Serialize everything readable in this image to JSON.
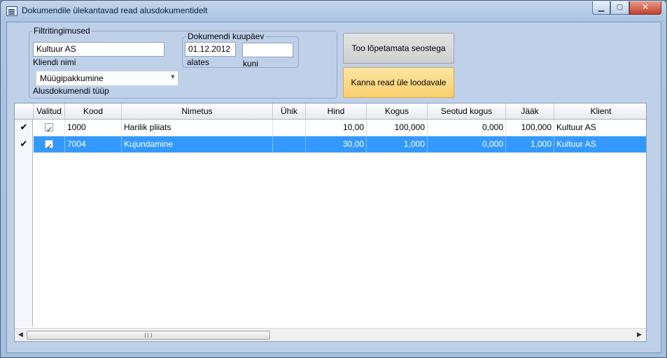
{
  "window": {
    "title": "Dokumendile ülekantavad read alusdokumentidelt",
    "min_symbol": "▁",
    "max_symbol": "▢",
    "close_symbol": "✕"
  },
  "filters": {
    "group_label": "Filtritingimused",
    "client_name_value": "Kultuur AS",
    "client_name_label": "Kliendi nimi",
    "date_group_label": "Dokumendi kuupäev",
    "date_from_value": "01.12.2012",
    "date_from_label": "alates",
    "date_to_value": "",
    "date_to_label": "kuni",
    "doc_type_value": "Müügipakkumine",
    "doc_type_label": "Alusdokumendi tüüp"
  },
  "buttons": {
    "unfinished_label": "Too lõpetamata seostega",
    "transfer_label": "Kanna read üle loodavale"
  },
  "grid": {
    "columns": [
      "Valitud",
      "Kood",
      "Nimetus",
      "Ühik",
      "Hind",
      "Kogus",
      "Seotud kogus",
      "Jääk",
      "Klient"
    ],
    "rows": [
      {
        "indicator": "✔",
        "checked": true,
        "kood": "1000",
        "nimetus": "Harilik pliiats",
        "yhik": "",
        "hind": "10,00",
        "kogus": "100,000",
        "seotud": "0,000",
        "jaak": "100,000",
        "klient": "Kultuur AS"
      },
      {
        "indicator": "✔",
        "checked": true,
        "kood": "7004",
        "nimetus": "Kujundamine",
        "yhik": "",
        "hind": "30,00",
        "kogus": "1,000",
        "seotud": "0,000",
        "jaak": "1,000",
        "klient": "Kultuur AS"
      }
    ],
    "selected_row": 1
  },
  "scrollbar": {
    "left_arrow": "◀",
    "right_arrow": "▶"
  },
  "colors": {
    "selection": "#3399ff",
    "transfer_button": "#f9cf6c",
    "window_frame": "#aac4e3"
  }
}
